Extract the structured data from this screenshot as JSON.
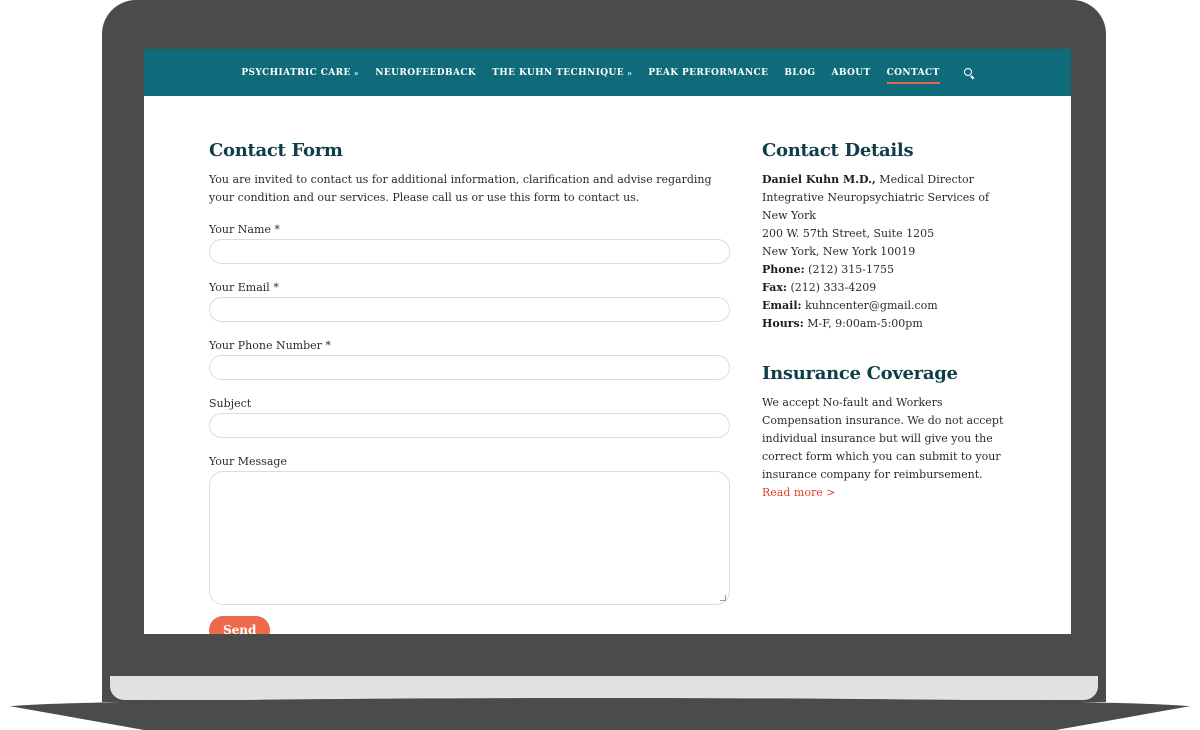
{
  "nav": {
    "items": [
      {
        "label": "PSYCHIATRIC CARE",
        "dropdown": true
      },
      {
        "label": "NEUROFEEDBACK",
        "dropdown": false
      },
      {
        "label": "THE KUHN TECHNIQUE",
        "dropdown": true
      },
      {
        "label": "PEAK PERFORMANCE",
        "dropdown": false
      },
      {
        "label": "BLOG",
        "dropdown": false
      },
      {
        "label": "ABOUT",
        "dropdown": false
      },
      {
        "label": "CONTACT",
        "dropdown": false,
        "active": true
      }
    ],
    "caret": "»",
    "search_icon": "search-icon",
    "bg_color": "#0f6b7a",
    "active_underline_color": "#e8684a"
  },
  "contact_form": {
    "title": "Contact Form",
    "intro": "You are invited to contact us for additional information, clarification and advise regarding your condition and our services. Please call us or use this form to contact us.",
    "fields": {
      "name_label": "Your Name *",
      "email_label": "Your Email *",
      "phone_label": "Your Phone Number *",
      "subject_label": "Subject",
      "message_label": "Your Message"
    },
    "send_label": "Send",
    "send_color": "#ee6a4c"
  },
  "contact_details": {
    "title": "Contact Details",
    "name": "Daniel Kuhn M.D.,",
    "role": " Medical Director",
    "org": "Integrative Neuropsychiatric Services of New York",
    "address1": "200 W. 57th Street, Suite 1205",
    "address2": "New York, New York 10019",
    "phone_label": "Phone:",
    "phone": " (212) 315-1755",
    "fax_label": "Fax:",
    "fax": " (212) 333-4209",
    "email_label": "Email:",
    "email": " kuhncenter@gmail.com",
    "hours_label": "Hours:",
    "hours": " M-F, 9:00am-5:00pm"
  },
  "insurance": {
    "title": "Insurance Coverage",
    "text": "We accept No-fault and Workers Compensation insurance. We do not accept individual insurance but will give you the correct form which you can submit to your insurance company for reimbursement. ",
    "read_more": "Read more >",
    "link_color": "#e0432a"
  },
  "scroll_top_icon": "chevron-up-icon"
}
